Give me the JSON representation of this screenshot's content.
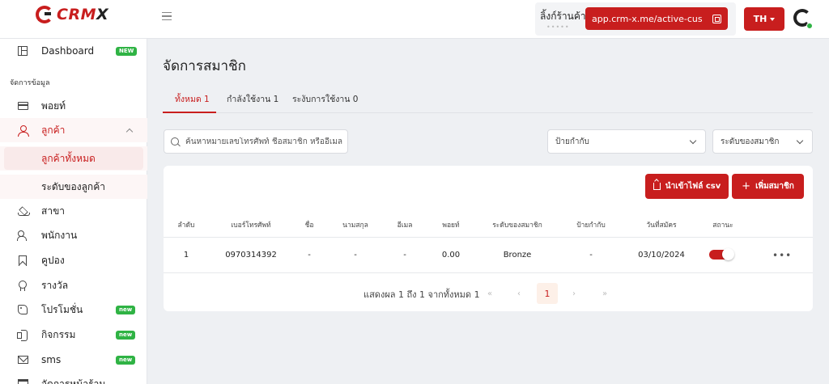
{
  "brand": {
    "logo_text_a": "CRM",
    "logo_text_b": "X"
  },
  "header": {
    "shop_link_label": "ลิ้งก์ร้านค้า",
    "shop_link_sub": "•••••",
    "shop_link_url": "app.crm-x.me/active-customer",
    "lang": "TH"
  },
  "sidebar": {
    "dashboard": {
      "label": "Dashboard",
      "badge": "NEW"
    },
    "section": "จัดการข้อมูล",
    "points": "พอยท์",
    "customers": "ลูกค้า",
    "all_customers": "ลูกค้าทั้งหมด",
    "customer_levels": "ระดับของลูกค้า",
    "branches": "สาขา",
    "staff": "พนักงาน",
    "coupons": "คูปอง",
    "rewards": "รางวัล",
    "promotions": {
      "label": "โปรโมชั่น",
      "badge": "new"
    },
    "activities": {
      "label": "กิจกรรม",
      "badge": "new"
    },
    "sms": {
      "label": "sms",
      "badge": "new"
    },
    "shop": "จัดการหน้าร้าน"
  },
  "main": {
    "title": "จัดการสมาชิก",
    "tabs": [
      {
        "label": "ทั้งหมด 1"
      },
      {
        "label": "กำลังใช้งาน 1"
      },
      {
        "label": "ระงับการใช้งาน 0"
      }
    ],
    "search_placeholder": "ค้นหาหมายเลขโทรศัพท์ ชื่อสมาชิก หรืออีเมล",
    "tag_select": "ป้ายกำกับ",
    "level_select": "ระดับของสมาชิก",
    "import_button": "นำเข้าไฟล์ csv",
    "add_button": "เพิ่มสมาชิก",
    "table": {
      "columns": [
        "ลำดับ",
        "เบอร์โทรศัพท์",
        "ชื่อ",
        "นามสกุล",
        "อีเมล",
        "พอยท์",
        "ระดับของสมาชิก",
        "ป้ายกำกับ",
        "วันที่สมัคร",
        "สถานะ"
      ],
      "rows": [
        [
          "1",
          "0970314392",
          "-",
          "-",
          "-",
          "0.00",
          "Bronze",
          "-",
          "03/10/2024"
        ]
      ]
    },
    "pagination": {
      "summary": "แสดงผล 1 ถึง 1 จากทั้งหมด 1",
      "first": "«",
      "prev": "‹",
      "current": "1",
      "next": "›",
      "last": "»"
    }
  },
  "colors": {
    "accent": "#c81e1e",
    "new_badge": "#2fb344"
  }
}
